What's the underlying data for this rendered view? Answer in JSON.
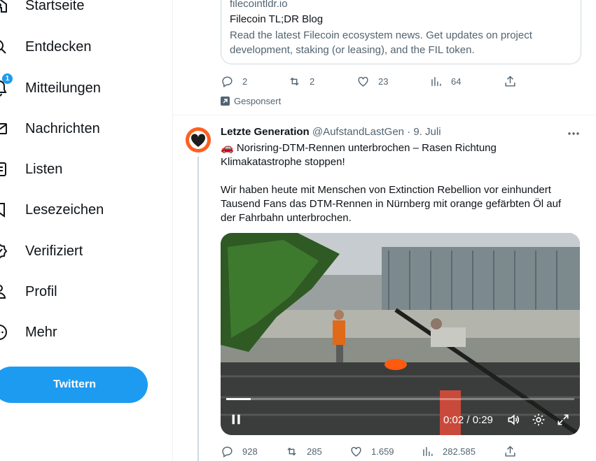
{
  "sidebar": {
    "items": [
      {
        "label": "Startseite",
        "icon": "home-icon"
      },
      {
        "label": "Entdecken",
        "icon": "search-icon"
      },
      {
        "label": "Mitteilungen",
        "icon": "bell-icon",
        "badge": "1"
      },
      {
        "label": "Nachrichten",
        "icon": "envelope-icon"
      },
      {
        "label": "Listen",
        "icon": "list-icon"
      },
      {
        "label": "Lesezeichen",
        "icon": "bookmark-icon"
      },
      {
        "label": "Verifiziert",
        "icon": "verified-icon"
      },
      {
        "label": "Profil",
        "icon": "person-icon"
      },
      {
        "label": "Mehr",
        "icon": "more-circle-icon"
      }
    ],
    "tweet_button": "Twittern"
  },
  "ad": {
    "card": {
      "domain": "filecointldr.io",
      "title": "Filecoin TL;DR Blog",
      "description": "Read the latest Filecoin ecosystem news. Get updates on project development, staking (or leasing), and the FIL token."
    },
    "actions": {
      "replies": "2",
      "retweets": "2",
      "likes": "23",
      "views": "64"
    },
    "sponsored_label": "Gesponsert"
  },
  "tweet": {
    "name": "Letzte Generation",
    "handle": "@AufstandLastGen",
    "separator": "·",
    "date": "9. Juli",
    "text_line1": "🚗 Norisring-DTM-Rennen unterbrochen – Rasen Richtung Klimakatastrophe stoppen!",
    "text_line2": "Wir haben heute mit Menschen von Extinction Rebellion vor einhundert Tausend Fans das DTM-Rennen in Nürnberg mit orange gefärbten Öl auf der Fahrbahn unterbrochen.",
    "video": {
      "time": "0:02 / 0:29",
      "progress": 0.07
    },
    "actions": {
      "replies": "928",
      "retweets": "285",
      "likes": "1.659",
      "views": "282.585"
    }
  },
  "colors": {
    "accent": "#1d9bf0",
    "muted": "#536471",
    "avatar": "#ff5f1f"
  }
}
